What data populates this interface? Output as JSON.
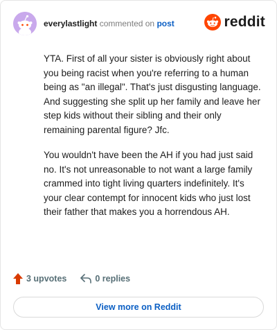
{
  "header": {
    "username": "everylastlight",
    "action_text": "commented on",
    "post_link": "post",
    "brand": "reddit",
    "avatar_icon": "reddit-snoo-avatar",
    "logo_icon": "reddit-alien-icon",
    "brand_color": "#ff4500"
  },
  "comment": {
    "paragraphs": [
      "YTA. First of all your sister is obviously right about you being racist when you're referring to a human being as \"an illegal\". That's just disgusting language. And suggesting she split up her family and leave her step kids without their sibling and their only remaining parental figure? Jfc.",
      "You wouldn't have been the AH if you had just said no. It's not unreasonable to not want a large family crammed into tight living quarters indefinitely. It's your clear contempt for innocent kids who just lost their father that makes you a horrendous AH."
    ]
  },
  "actions": {
    "upvotes": "3 upvotes",
    "replies": "0 replies",
    "upvote_icon": "upvote-arrow-icon",
    "reply_icon": "reply-arrow-icon"
  },
  "footer": {
    "view_more": "View more on Reddit"
  }
}
